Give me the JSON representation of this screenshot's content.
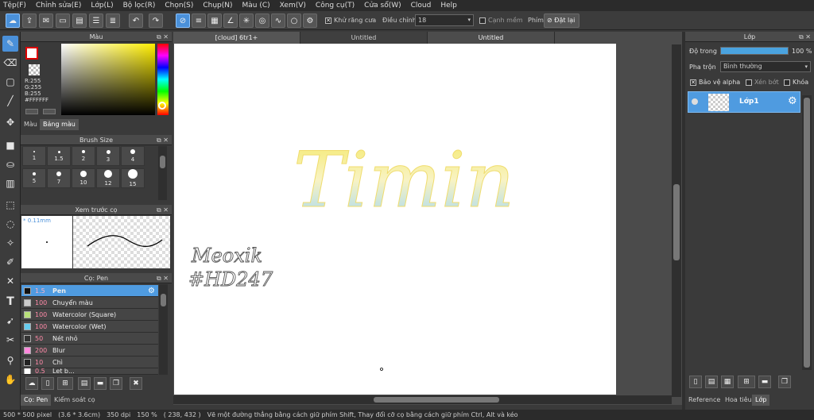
{
  "menu": [
    "Tệp(F)",
    "Chỉnh sửa(E)",
    "Lớp(L)",
    "Bộ lọc(R)",
    "Chọn(S)",
    "Chụp(N)",
    "Màu (C)",
    "Xem(V)",
    "Công cụ(T)",
    "Cửa sổ(W)",
    "Cloud",
    "Help"
  ],
  "toolbar": {
    "antialias_label": "Khử răng cưa",
    "adjust_label": "Điều chỉnh",
    "adjust_value": "18",
    "edge_label": "Cạnh mềm",
    "key_label": "Phím",
    "reset_label": "Đặt lại"
  },
  "color_panel": {
    "title": "Màu",
    "r": "R:255",
    "g": "G:255",
    "b": "B:255",
    "hex": "#FFFFFF",
    "tab_color": "Màu",
    "tab_palette": "Bảng màu"
  },
  "brush_size_panel": {
    "title": "Brush Size",
    "sizes": [
      "1",
      "1.5",
      "2",
      "3",
      "4",
      "5",
      "7",
      "10",
      "12",
      "15"
    ]
  },
  "preview_panel": {
    "title": "Xem trước cọ",
    "size": "* 0.11mm"
  },
  "brush_panel": {
    "title": "Cọ: Pen",
    "items": [
      {
        "size": "1.5",
        "name": "Pen",
        "color": "#111111"
      },
      {
        "size": "100",
        "name": "Chuyển màu",
        "color": "#cccccc"
      },
      {
        "size": "100",
        "name": "Watercolor (Square)",
        "color": "#b8e07a"
      },
      {
        "size": "100",
        "name": "Watercolor (Wet)",
        "color": "#66ccee"
      },
      {
        "size": "50",
        "name": "Nét nhỏ",
        "color": "#333333"
      },
      {
        "size": "200",
        "name": "Blur",
        "color": "#ff88dd"
      },
      {
        "size": "10",
        "name": "Chì",
        "color": "#222222"
      },
      {
        "size": "0.5",
        "name": "Let b...",
        "color": "#ffffff"
      }
    ],
    "tab_brush": "Cọ: Pen",
    "tab_control": "Kiểm soát cọ"
  },
  "doc_tabs": [
    "[cloud] 6tr1+",
    "Untitled",
    "Untitled"
  ],
  "canvas_text": {
    "title_art": "Timin",
    "sig1": "Meoxik",
    "sig2": "#HD247"
  },
  "layer_panel": {
    "title": "Lớp",
    "opacity_label": "Độ trong",
    "opacity_value": "100 %",
    "opacity_fraction": 1.0,
    "blend_label": "Pha trộn",
    "blend_value": "Bình thường",
    "protect_alpha": "Bảo vệ alpha",
    "clip": "Xén bớt",
    "lock": "Khóa",
    "layer_name": "Lớp1",
    "tab_reference": "Reference",
    "tab_navigator": "Hoa tiêu",
    "tab_layer": "Lớp"
  },
  "status": {
    "size": "500 * 500 pixel",
    "cm": "(3.6 * 3.6cm)",
    "dpi": "350 dpi",
    "zoom": "150 %",
    "coord": "( 238, 432 )",
    "hint": "Vẽ một đường thẳng bằng cách giữ phím Shift, Thay đổi cỡ cọ bằng cách giữ phím Ctrl, Alt và kéo"
  },
  "colors": {
    "accent": "#4a90d9",
    "gradient_yellow": "#f5e96a",
    "gradient_blue": "#9fd6f5"
  }
}
